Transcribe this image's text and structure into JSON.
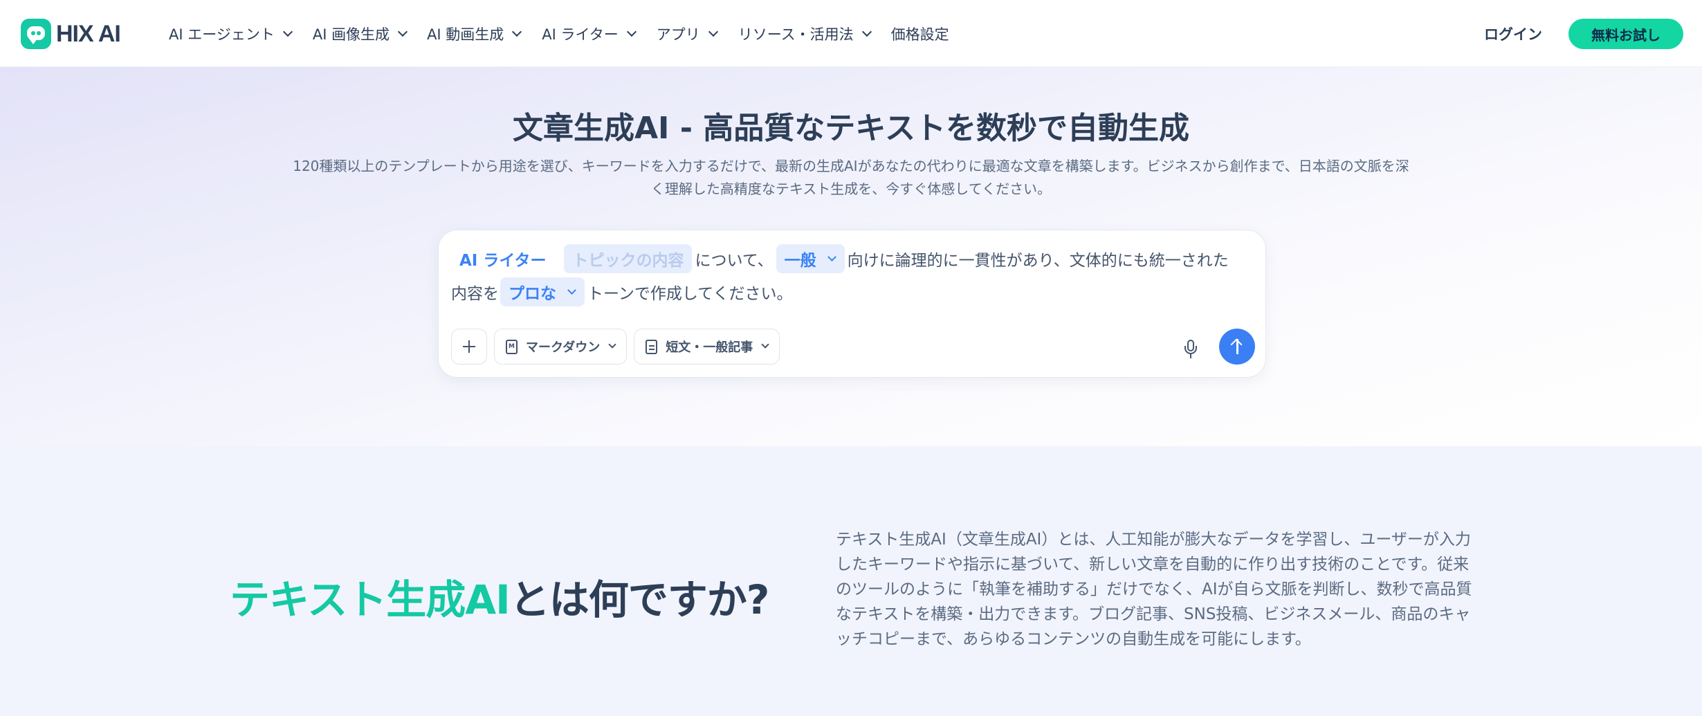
{
  "header": {
    "logo_text": "HIX AI",
    "nav": [
      {
        "label": "AI エージェント",
        "has_dropdown": true
      },
      {
        "label": "AI 画像生成",
        "has_dropdown": true
      },
      {
        "label": "AI 動画生成",
        "has_dropdown": true
      },
      {
        "label": "AI ライター",
        "has_dropdown": true
      },
      {
        "label": "アプリ",
        "has_dropdown": true
      },
      {
        "label": "リソース・活用法",
        "has_dropdown": true
      },
      {
        "label": "価格設定",
        "has_dropdown": false
      }
    ],
    "login_label": "ログイン",
    "trial_label": "無料お試し"
  },
  "hero": {
    "title": "文章生成AI - 高品質なテキストを数秒で自動生成",
    "description": "120種類以上のテンプレートから用途を選び、キーワードを入力するだけで、最新の生成AIがあなたの代わりに最適な文章を構築します。ビジネスから創作まで、日本語の文脈を深く理解した高精度なテキスト生成を、今すぐ体感してください。"
  },
  "prompt": {
    "writer_tag": "AI ライター",
    "topic_placeholder": "トピックの内容",
    "text_about": "について、",
    "audience_value": "一般",
    "text_mid": "向けに論理的に一貫性があり、文体的にも統一された",
    "text_content": "内容を",
    "tone_value": "プロな",
    "text_end": "トーンで作成してください。",
    "format_label": "マークダウン",
    "length_label": "短文・一般記事",
    "icons": {
      "add": "plus-icon",
      "format": "markdown-file-icon",
      "length": "document-icon",
      "mic": "microphone-icon",
      "send": "arrow-up-icon"
    }
  },
  "about": {
    "title_accent": "テキスト生成AI",
    "title_rest": "とは何ですか?",
    "body": "テキスト生成AI（文章生成AI）とは、人工知能が膨大なデータを学習し、ユーザーが入力したキーワードや指示に基づいて、新しい文章を自動的に作り出す技術のことです。従来のツールのように「執筆を補助する」だけでなく、AIが自ら文脈を判断し、数秒で高品質なテキストを構築・出力できます。ブログ記事、SNS投稿、ビジネスメール、商品のキャッチコピーまで、あらゆるコンテンツの自動生成を可能にします。"
  },
  "colors": {
    "brand_green": "#14c9a3",
    "accent_blue": "#3b82f6",
    "text_dark": "#2d3e57"
  }
}
